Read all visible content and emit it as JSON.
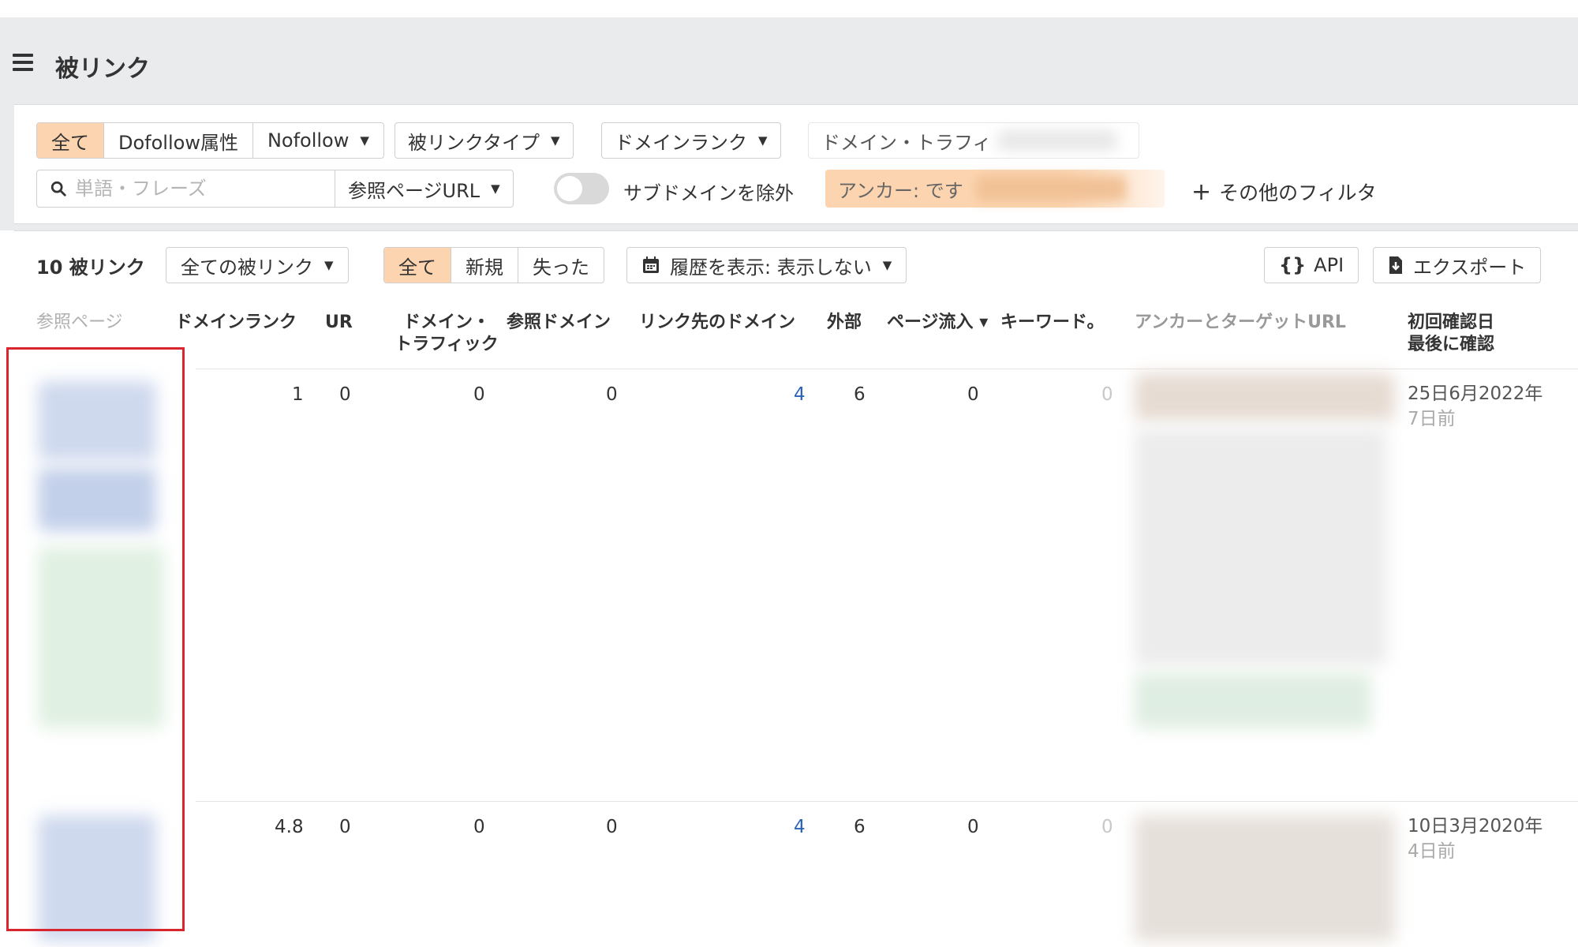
{
  "header": {
    "title": "被リンク"
  },
  "filters": {
    "follow_segment": [
      "全て",
      "Dofollow属性",
      "Nofollow"
    ],
    "backlink_type": "被リンクタイプ",
    "domain_rank": "ドメインランク",
    "domain_traffic": "ドメイン・トラフィ",
    "search_placeholder": "単語・フレーズ",
    "search_value": "",
    "ref_page_url": "参照ページURL",
    "exclude_subdomains": "サブドメインを除外",
    "anchor_chip": "アンカー: です",
    "more_filters": "その他のフィルタ"
  },
  "toolbar": {
    "count": "10 被リンク",
    "all_backlinks": "全ての被リンク",
    "status_segment": [
      "全て",
      "新規",
      "失った"
    ],
    "history": "履歴を表示: 表示しない",
    "api": "API",
    "export": "エクスポート"
  },
  "table": {
    "columns": {
      "ref_page": "参照ページ",
      "domain_rank": "ドメインランク",
      "ur": "UR",
      "domain_traffic_1": "ドメイン・",
      "domain_traffic_2": "トラフィック",
      "ref_domains": "参照ドメイン",
      "linked_domains": "リンク先のドメイン",
      "external": "外部",
      "page_traffic": "ページ流入 ▾",
      "keywords": "キーワード。",
      "anchor_target": "アンカーとターゲットURL",
      "first_seen": "初回確認日",
      "last_seen": "最後に確認"
    },
    "rows": [
      {
        "domain_rank": "1",
        "ur": "0",
        "domain_traffic": "0",
        "ref_domains": "0",
        "linked_domains": "4",
        "external": "6",
        "page_traffic": "0",
        "keywords": "0",
        "first_seen": "25日6月2022年",
        "last_seen": "7日前"
      },
      {
        "domain_rank": "4.8",
        "ur": "0",
        "domain_traffic": "0",
        "ref_domains": "0",
        "linked_domains": "4",
        "external": "6",
        "page_traffic": "0",
        "keywords": "0",
        "first_seen": "10日3月2020年",
        "last_seen": "4日前"
      }
    ]
  },
  "colors": {
    "accent_segment": "#fcd5b0",
    "link_blue": "#2a63b8",
    "highlight_red": "#d8262f",
    "header_bg": "#eaebed"
  },
  "icons": [
    "menu-icon",
    "search-icon",
    "calendar-icon",
    "api-braces-icon",
    "export-icon",
    "plus-icon",
    "caret-down-icon"
  ]
}
